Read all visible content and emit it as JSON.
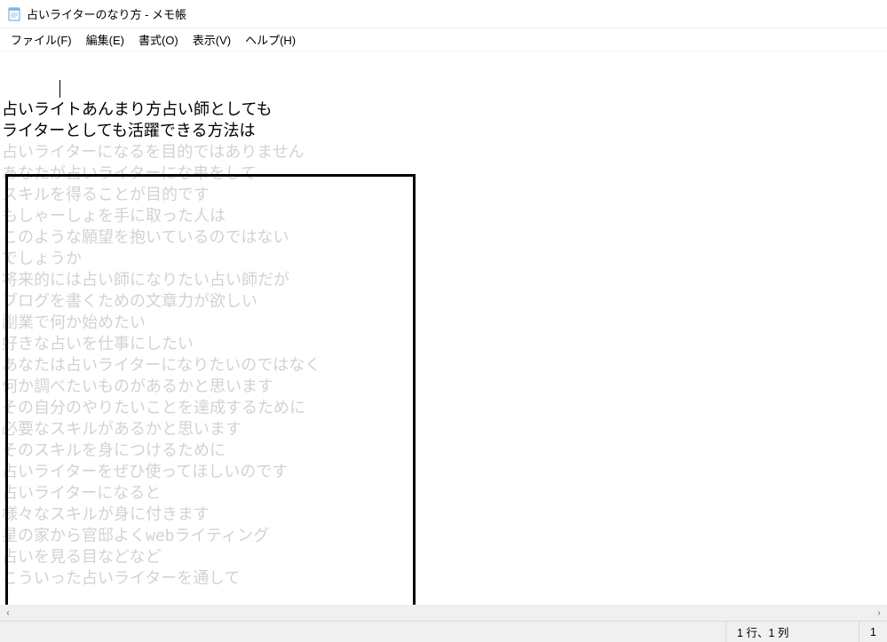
{
  "window": {
    "title": "占いライターのなり方 - メモ帳"
  },
  "menu": {
    "file": "ファイル(F)",
    "edit": "編集(E)",
    "format": "書式(O)",
    "view": "表示(V)",
    "help": "ヘルプ(H)"
  },
  "editor": {
    "visible_lines": [
      "",
      "占いライトあんまり方占い師としても",
      "ライターとしても活躍できる方法は"
    ],
    "faded_lines": [
      "占いライターになるを目的ではありません",
      "あなたが占いライターにな串をして",
      "スキルを得ることが目的です",
      "もしゃーしょを手に取った人は",
      "このような願望を抱いているのではない",
      "でしょうか",
      "将来的には占い師になりたい占い師だが",
      "ブログを書くための文章力が欲しい",
      "副業で何か始めたい",
      "好きな占いを仕事にしたい",
      "あなたは占いライターになりたいのではなく",
      "何か調べたいものがあるかと思います",
      "その自分のやりたいことを達成するために",
      "必要なスキルがあるかと思います",
      "そのスキルを身につけるために",
      "占いライターをぜひ使ってほしいのです",
      "占いライターになると",
      "様々なスキルが身に付きます",
      "星の家から官邸よくwebライティング",
      "占いを見る目などなど",
      "こういった占いライターを通して"
    ]
  },
  "status": {
    "position": "1 行、1 列",
    "zoom_trail": "1"
  },
  "icons": {
    "app": "notepad-icon",
    "scroll_left": "‹",
    "scroll_right": "›"
  }
}
